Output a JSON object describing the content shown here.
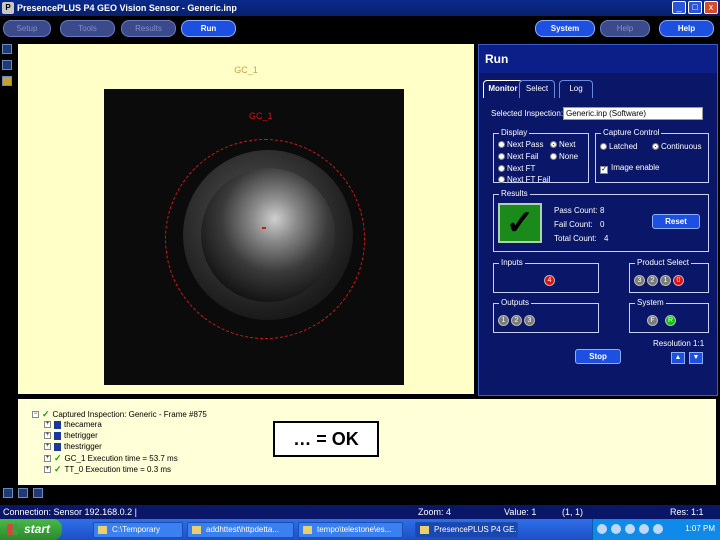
{
  "window": {
    "title": "PresencePLUS P4 GEO Vision Sensor - Generic.inp",
    "app_icon": "app-icon",
    "controls": [
      "_",
      "□",
      "x"
    ]
  },
  "nav": {
    "buttons": [
      {
        "label": "Setup",
        "active": false
      },
      {
        "label": "Tools",
        "active": false
      },
      {
        "label": "Results",
        "active": false
      },
      {
        "label": "Run",
        "active": true
      },
      {
        "label": "System",
        "active": true
      },
      {
        "label": "Help",
        "active": false
      },
      {
        "label": "Help",
        "active": true
      }
    ]
  },
  "image": {
    "label": "GC_1",
    "overlay_label": "GC_1"
  },
  "run": {
    "title": "Run",
    "tabs": [
      "Monitor",
      "Select",
      "Log"
    ],
    "selected_inspection_label": "Selected Inspection:",
    "selected_inspection_value": "Generic.inp (Software)",
    "display": {
      "title": "Display",
      "options": [
        "Next Pass",
        "Next",
        "Next Fail",
        "None",
        "Next FT",
        "Next FT Fail"
      ]
    },
    "capture": {
      "title": "Capture Control",
      "options": [
        "Latched",
        "Continuous"
      ],
      "image_enable": "Image enable"
    },
    "results": {
      "title": "Results",
      "pass_label": "Pass Count:",
      "pass_value": "8",
      "fail_label": "Fail Count:",
      "fail_value": "0",
      "total_label": "Total Count:",
      "total_value": "4",
      "reset": "Reset"
    },
    "inputs": {
      "title": "Inputs",
      "pins": [
        "4"
      ]
    },
    "product_select": {
      "title": "Product Select",
      "pins": [
        "3",
        "2",
        "1",
        "0"
      ]
    },
    "outputs": {
      "title": "Outputs",
      "pins": [
        "1",
        "2",
        "3"
      ]
    },
    "system": {
      "title": "System",
      "pins": [
        "F",
        "R"
      ]
    },
    "resolution": "Resolution 1:1",
    "stop": "Stop"
  },
  "tree": {
    "rows": [
      {
        "label": "Captured Inspection: Generic - Frame #875",
        "level": 0
      },
      {
        "label": "thecamera",
        "level": 1
      },
      {
        "label": "thetrigger",
        "level": 1
      },
      {
        "label": "thestrigger",
        "level": 1
      },
      {
        "label": "GC_1 Execution time = 53.7 ms",
        "level": 1
      },
      {
        "label": "TT_0 Execution time = 0.3 ms",
        "level": 1
      }
    ],
    "ok_badge": "… = OK"
  },
  "status": {
    "connection": "Connection: Sensor 192.168.0.2 |",
    "zoom": "Zoom: 4",
    "value": "Value: 1",
    "coords": "(1, 1)",
    "res": "Res: 1:1"
  },
  "taskbar": {
    "start": "start",
    "items": [
      {
        "label": "C:\\Temporary",
        "active": false
      },
      {
        "label": "addhttest\\httpdetta...",
        "active": false
      },
      {
        "label": "tempo\\telestone\\es...",
        "active": false
      },
      {
        "label": "PresencePLUS P4 GE...",
        "active": true
      }
    ],
    "clock": "1:07 PM"
  }
}
